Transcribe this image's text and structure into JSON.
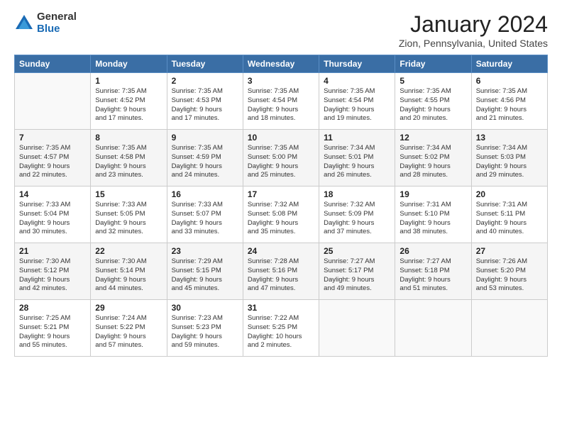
{
  "logo": {
    "general": "General",
    "blue": "Blue"
  },
  "header": {
    "month": "January 2024",
    "location": "Zion, Pennsylvania, United States"
  },
  "days_of_week": [
    "Sunday",
    "Monday",
    "Tuesday",
    "Wednesday",
    "Thursday",
    "Friday",
    "Saturday"
  ],
  "weeks": [
    [
      {
        "day": "",
        "info": ""
      },
      {
        "day": "1",
        "info": "Sunrise: 7:35 AM\nSunset: 4:52 PM\nDaylight: 9 hours\nand 17 minutes."
      },
      {
        "day": "2",
        "info": "Sunrise: 7:35 AM\nSunset: 4:53 PM\nDaylight: 9 hours\nand 17 minutes."
      },
      {
        "day": "3",
        "info": "Sunrise: 7:35 AM\nSunset: 4:54 PM\nDaylight: 9 hours\nand 18 minutes."
      },
      {
        "day": "4",
        "info": "Sunrise: 7:35 AM\nSunset: 4:54 PM\nDaylight: 9 hours\nand 19 minutes."
      },
      {
        "day": "5",
        "info": "Sunrise: 7:35 AM\nSunset: 4:55 PM\nDaylight: 9 hours\nand 20 minutes."
      },
      {
        "day": "6",
        "info": "Sunrise: 7:35 AM\nSunset: 4:56 PM\nDaylight: 9 hours\nand 21 minutes."
      }
    ],
    [
      {
        "day": "7",
        "info": "Sunrise: 7:35 AM\nSunset: 4:57 PM\nDaylight: 9 hours\nand 22 minutes."
      },
      {
        "day": "8",
        "info": "Sunrise: 7:35 AM\nSunset: 4:58 PM\nDaylight: 9 hours\nand 23 minutes."
      },
      {
        "day": "9",
        "info": "Sunrise: 7:35 AM\nSunset: 4:59 PM\nDaylight: 9 hours\nand 24 minutes."
      },
      {
        "day": "10",
        "info": "Sunrise: 7:35 AM\nSunset: 5:00 PM\nDaylight: 9 hours\nand 25 minutes."
      },
      {
        "day": "11",
        "info": "Sunrise: 7:34 AM\nSunset: 5:01 PM\nDaylight: 9 hours\nand 26 minutes."
      },
      {
        "day": "12",
        "info": "Sunrise: 7:34 AM\nSunset: 5:02 PM\nDaylight: 9 hours\nand 28 minutes."
      },
      {
        "day": "13",
        "info": "Sunrise: 7:34 AM\nSunset: 5:03 PM\nDaylight: 9 hours\nand 29 minutes."
      }
    ],
    [
      {
        "day": "14",
        "info": "Sunrise: 7:33 AM\nSunset: 5:04 PM\nDaylight: 9 hours\nand 30 minutes."
      },
      {
        "day": "15",
        "info": "Sunrise: 7:33 AM\nSunset: 5:05 PM\nDaylight: 9 hours\nand 32 minutes."
      },
      {
        "day": "16",
        "info": "Sunrise: 7:33 AM\nSunset: 5:07 PM\nDaylight: 9 hours\nand 33 minutes."
      },
      {
        "day": "17",
        "info": "Sunrise: 7:32 AM\nSunset: 5:08 PM\nDaylight: 9 hours\nand 35 minutes."
      },
      {
        "day": "18",
        "info": "Sunrise: 7:32 AM\nSunset: 5:09 PM\nDaylight: 9 hours\nand 37 minutes."
      },
      {
        "day": "19",
        "info": "Sunrise: 7:31 AM\nSunset: 5:10 PM\nDaylight: 9 hours\nand 38 minutes."
      },
      {
        "day": "20",
        "info": "Sunrise: 7:31 AM\nSunset: 5:11 PM\nDaylight: 9 hours\nand 40 minutes."
      }
    ],
    [
      {
        "day": "21",
        "info": "Sunrise: 7:30 AM\nSunset: 5:12 PM\nDaylight: 9 hours\nand 42 minutes."
      },
      {
        "day": "22",
        "info": "Sunrise: 7:30 AM\nSunset: 5:14 PM\nDaylight: 9 hours\nand 44 minutes."
      },
      {
        "day": "23",
        "info": "Sunrise: 7:29 AM\nSunset: 5:15 PM\nDaylight: 9 hours\nand 45 minutes."
      },
      {
        "day": "24",
        "info": "Sunrise: 7:28 AM\nSunset: 5:16 PM\nDaylight: 9 hours\nand 47 minutes."
      },
      {
        "day": "25",
        "info": "Sunrise: 7:27 AM\nSunset: 5:17 PM\nDaylight: 9 hours\nand 49 minutes."
      },
      {
        "day": "26",
        "info": "Sunrise: 7:27 AM\nSunset: 5:18 PM\nDaylight: 9 hours\nand 51 minutes."
      },
      {
        "day": "27",
        "info": "Sunrise: 7:26 AM\nSunset: 5:20 PM\nDaylight: 9 hours\nand 53 minutes."
      }
    ],
    [
      {
        "day": "28",
        "info": "Sunrise: 7:25 AM\nSunset: 5:21 PM\nDaylight: 9 hours\nand 55 minutes."
      },
      {
        "day": "29",
        "info": "Sunrise: 7:24 AM\nSunset: 5:22 PM\nDaylight: 9 hours\nand 57 minutes."
      },
      {
        "day": "30",
        "info": "Sunrise: 7:23 AM\nSunset: 5:23 PM\nDaylight: 9 hours\nand 59 minutes."
      },
      {
        "day": "31",
        "info": "Sunrise: 7:22 AM\nSunset: 5:25 PM\nDaylight: 10 hours\nand 2 minutes."
      },
      {
        "day": "",
        "info": ""
      },
      {
        "day": "",
        "info": ""
      },
      {
        "day": "",
        "info": ""
      }
    ]
  ]
}
